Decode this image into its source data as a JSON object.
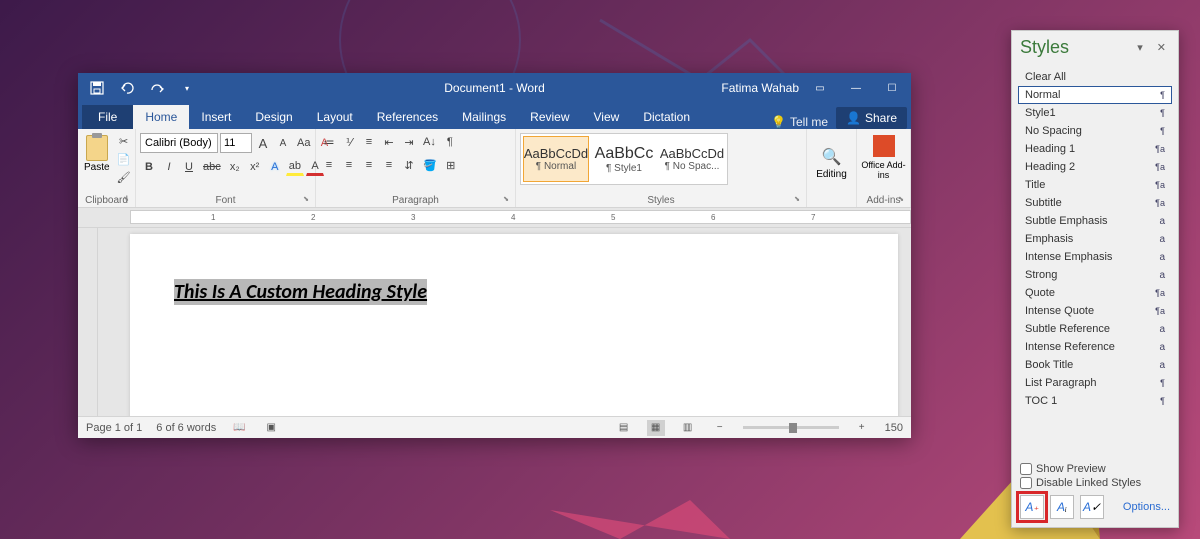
{
  "title_bar": {
    "document_title": "Document1 - Word",
    "user_name": "Fatima Wahab"
  },
  "tabs": {
    "file": "File",
    "home": "Home",
    "insert": "Insert",
    "design": "Design",
    "layout": "Layout",
    "references": "References",
    "mailings": "Mailings",
    "review": "Review",
    "view": "View",
    "dictation": "Dictation",
    "tell_me": "Tell me",
    "share": "Share"
  },
  "ribbon": {
    "clipboard": {
      "label": "Clipboard",
      "paste": "Paste"
    },
    "font": {
      "label": "Font",
      "name": "Calibri (Body)",
      "size": "11",
      "grow": "A",
      "shrink": "A",
      "case": "Aa",
      "clear": "A",
      "bold": "B",
      "italic": "I",
      "underline": "U",
      "strike": "abc",
      "sub": "x₂",
      "sup": "x²",
      "texteffects": "A",
      "highlight": "ab",
      "color": "A"
    },
    "paragraph": {
      "label": "Paragraph"
    },
    "styles": {
      "label": "Styles",
      "preview_text": "AaBbCcDd",
      "preview_text_big": "AaBbCc",
      "items": [
        {
          "name": "¶ Normal"
        },
        {
          "name": "¶ Style1"
        },
        {
          "name": "¶ No Spac..."
        }
      ]
    },
    "editing": {
      "label": "Editing"
    },
    "addins": {
      "label": "Add-ins",
      "office": "Office Add-ins"
    }
  },
  "document": {
    "heading_text": "This Is A Custom Heading Style"
  },
  "status": {
    "page": "Page 1 of 1",
    "words": "6 of 6 words",
    "zoom": "150"
  },
  "styles_pane": {
    "title": "Styles",
    "items": [
      {
        "label": "Clear All",
        "sym": ""
      },
      {
        "label": "Normal",
        "sym": "¶",
        "selected": true
      },
      {
        "label": "Style1",
        "sym": "¶"
      },
      {
        "label": "No Spacing",
        "sym": "¶"
      },
      {
        "label": "Heading 1",
        "sym": "¶a"
      },
      {
        "label": "Heading 2",
        "sym": "¶a"
      },
      {
        "label": "Title",
        "sym": "¶a"
      },
      {
        "label": "Subtitle",
        "sym": "¶a"
      },
      {
        "label": "Subtle Emphasis",
        "sym": "a"
      },
      {
        "label": "Emphasis",
        "sym": "a"
      },
      {
        "label": "Intense Emphasis",
        "sym": "a"
      },
      {
        "label": "Strong",
        "sym": "a"
      },
      {
        "label": "Quote",
        "sym": "¶a"
      },
      {
        "label": "Intense Quote",
        "sym": "¶a"
      },
      {
        "label": "Subtle Reference",
        "sym": "a"
      },
      {
        "label": "Intense Reference",
        "sym": "a"
      },
      {
        "label": "Book Title",
        "sym": "a"
      },
      {
        "label": "List Paragraph",
        "sym": "¶"
      },
      {
        "label": "TOC 1",
        "sym": "¶"
      }
    ],
    "show_preview": "Show Preview",
    "disable_linked": "Disable Linked Styles",
    "options": "Options..."
  }
}
